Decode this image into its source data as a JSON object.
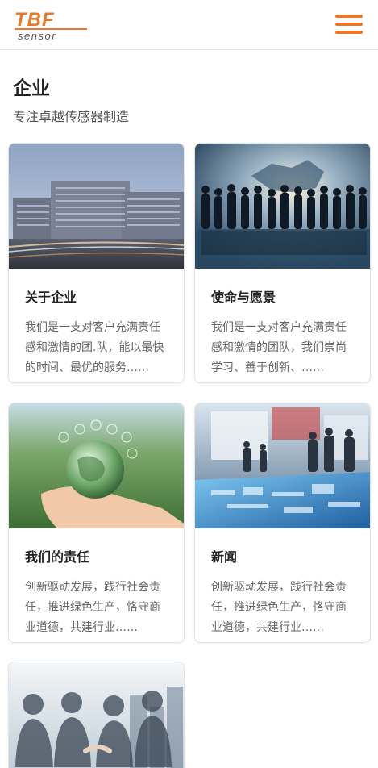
{
  "header": {
    "logo_text_top": "TBF",
    "logo_text_bottom": "sensor",
    "brand_color": "#e8782a"
  },
  "page": {
    "title": "企业",
    "subtitle": "专注卓越传感器制造"
  },
  "cards": [
    {
      "title": "关于企业",
      "desc": "我们是一支对客户充满责任感和激情的团.队，能以最快的时间、最优的服务……",
      "image": "office-buildings"
    },
    {
      "title": "使命与愿景",
      "desc": "我们是一支对客户充满责任感和激情的团队，我们崇尚学习、善于创新、……",
      "image": "team-silhouettes"
    },
    {
      "title": "我们的责任",
      "desc": "创新驱动发展，践行社会责任，推进绿色生产，恪守商业道德，共建行业……",
      "image": "hand-globe"
    },
    {
      "title": "新闻",
      "desc": "创新驱动发展，践行社会责任，推进绿色生产，恪守商业道德，共建行业……",
      "image": "exhibition-hall"
    },
    {
      "title": "",
      "desc": "",
      "image": "business-handshake"
    }
  ]
}
